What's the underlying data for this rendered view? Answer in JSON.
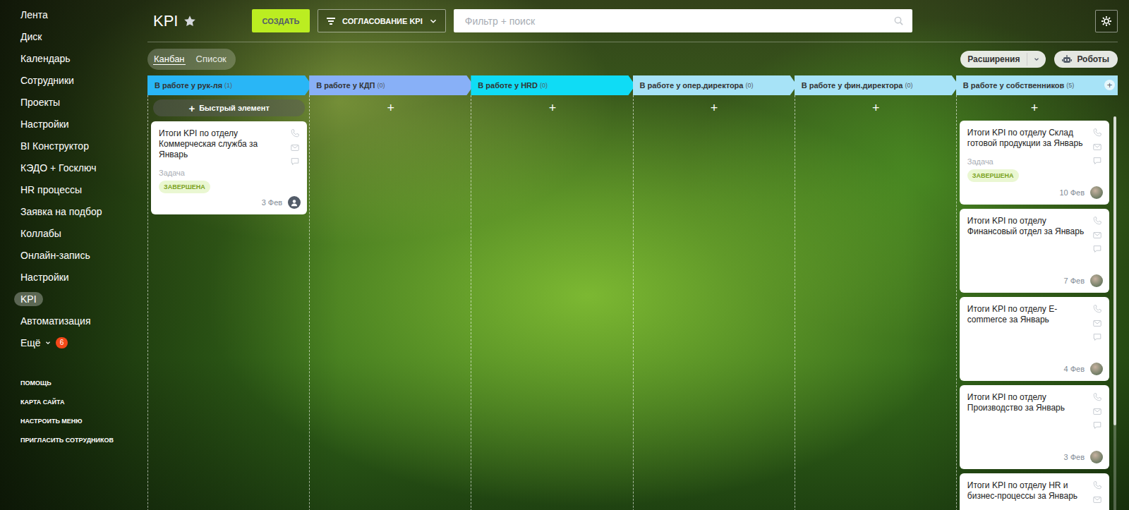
{
  "sidebar": {
    "items": [
      {
        "label": "Лента",
        "selected": false
      },
      {
        "label": "Диск",
        "selected": false
      },
      {
        "label": "Календарь",
        "selected": false
      },
      {
        "label": "Сотрудники",
        "selected": false
      },
      {
        "label": "Проекты",
        "selected": false
      },
      {
        "label": "Настройки",
        "selected": false
      },
      {
        "label": "BI Конструктор",
        "selected": false
      },
      {
        "label": "КЭДО + Госключ",
        "selected": false
      },
      {
        "label": "HR процессы",
        "selected": false
      },
      {
        "label": "Заявка на подбор",
        "selected": false
      },
      {
        "label": "Коллабы",
        "selected": false
      },
      {
        "label": "Онлайн-запись",
        "selected": false
      },
      {
        "label": "Настройки",
        "selected": false
      },
      {
        "label": "KPI",
        "selected": true
      },
      {
        "label": "Автоматизация",
        "selected": false
      },
      {
        "label": "Ещё",
        "selected": false,
        "badge": "6"
      }
    ],
    "footer": [
      {
        "label": "ПОМОЩЬ"
      },
      {
        "label": "КАРТА САЙТА"
      },
      {
        "label": "НАСТРОИТЬ МЕНЮ"
      },
      {
        "label": "ПРИГЛАСИТЬ СОТРУДНИКОВ"
      }
    ]
  },
  "header": {
    "title": "KPI",
    "create_button": "СОЗДАТЬ",
    "filter_button": "СОГЛАСОВАНИЕ KPI",
    "search": {
      "placeholder": "Фильтр + поиск"
    }
  },
  "view_tabs": [
    {
      "label": "Канбан",
      "selected": true
    },
    {
      "label": "Список",
      "selected": false
    }
  ],
  "toolbar": {
    "extensions": "Расширения",
    "robots": "Роботы"
  },
  "columns": [
    {
      "title": "В работе у рук-ля",
      "count": "(1)",
      "color": "#29b6f6",
      "quick_add": {
        "icon": "+",
        "label": "Быстрый элемент"
      },
      "cards": [
        {
          "title": "Итоги KPI по отделу Коммерческая служба за Январь",
          "type": "Задача",
          "status": "ЗАВЕРШЕНА",
          "date": "3 Фев",
          "avatar_kind": "placeholder"
        }
      ]
    },
    {
      "title": "В работе у КДП",
      "count": "(0)",
      "color": "#88b0f7",
      "add": "+",
      "cards": []
    },
    {
      "title": "В работе у HRD",
      "count": "(0)",
      "color": "#0fdcf5",
      "add": "+",
      "cards": []
    },
    {
      "title": "В работе у опер.директора",
      "count": "(0)",
      "color": "#a7e3f7",
      "add": "+",
      "cards": []
    },
    {
      "title": "В работе у фин.директора",
      "count": "(0)",
      "color": "#a7e3f7",
      "add": "+",
      "cards": []
    },
    {
      "title": "В работе у собственников",
      "count": "(5)",
      "color": "#a7e3f7",
      "add": "+",
      "header_add": "+",
      "cards": [
        {
          "title": "Итоги KPI по отделу Склад готовой продукции за Январь",
          "type": "Задача",
          "status": "ЗАВЕРШЕНА",
          "date": "10 Фев",
          "avatar_kind": "photo"
        },
        {
          "title": "Итоги KPI по отделу Финансовый отдел за Январь",
          "date": "7 Фев",
          "avatar_kind": "photo"
        },
        {
          "title": "Итоги KPI по отделу E-commerce за Январь",
          "date": "4 Фев",
          "avatar_kind": "photo"
        },
        {
          "title": "Итоги KPI по отделу Производство за Январь",
          "date": "3 Фев",
          "avatar_kind": "photo"
        },
        {
          "title": "Итоги KPI по отделу HR и бизнес-процессы за Январь"
        }
      ]
    }
  ]
}
